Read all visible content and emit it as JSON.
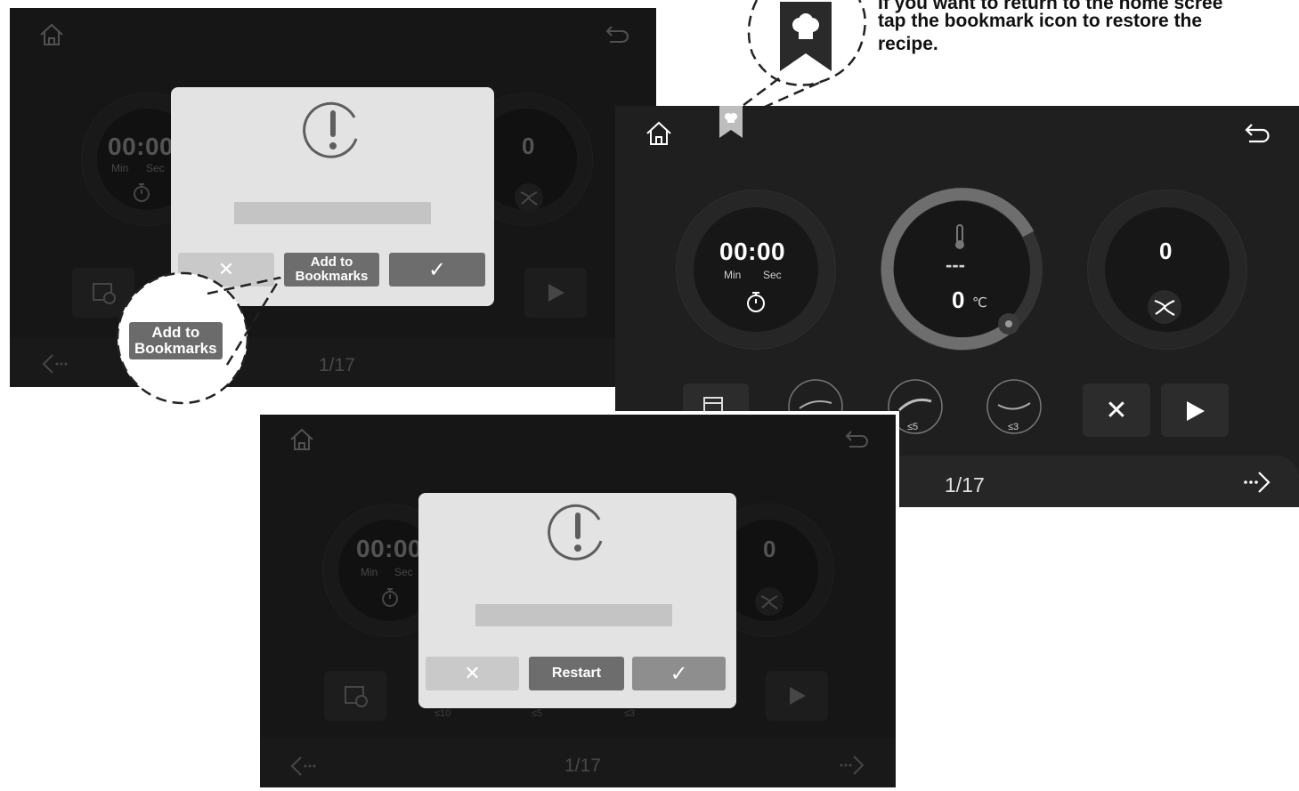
{
  "callout": {
    "line1": "If you want to return to the home scree",
    "line2": "tap the bookmark icon to restore the",
    "line3": "recipe."
  },
  "zoom_label": "Add to\nBookmarks",
  "screen_top_left": {
    "timer": "00:00",
    "min_label": "Min",
    "sec_label": "Sec",
    "fan_value": "0",
    "page": "1/17",
    "dialog": {
      "cancel_symbol": "✕",
      "middle_button": "Add to\nBookmarks",
      "confirm_symbol": "✓"
    }
  },
  "screen_right": {
    "timer": "00:00",
    "min_label": "Min",
    "sec_label": "Sec",
    "temp_dash": "---",
    "temp_value": "0",
    "temp_unit": "℃",
    "fan_value": "0",
    "speed_label_a": "≤5",
    "speed_label_b": "≤3",
    "stop_symbol": "✕",
    "page": "1/17"
  },
  "screen_bottom": {
    "timer": "00:00",
    "min_label": "Min",
    "sec_label": "Sec",
    "fan_value": "0",
    "speed_label_a": "≤10",
    "speed_label_b": "≤5",
    "speed_label_c": "≤3",
    "page": "1/17",
    "dialog": {
      "cancel_symbol": "✕",
      "middle_button": "Restart",
      "confirm_symbol": "✓"
    }
  },
  "colors": {
    "screen_bg": "#1f1f1f",
    "dialog_bg": "#e3e3e3",
    "button_dark": "#6d6d6d",
    "accent_gray": "#8a8a8a"
  }
}
